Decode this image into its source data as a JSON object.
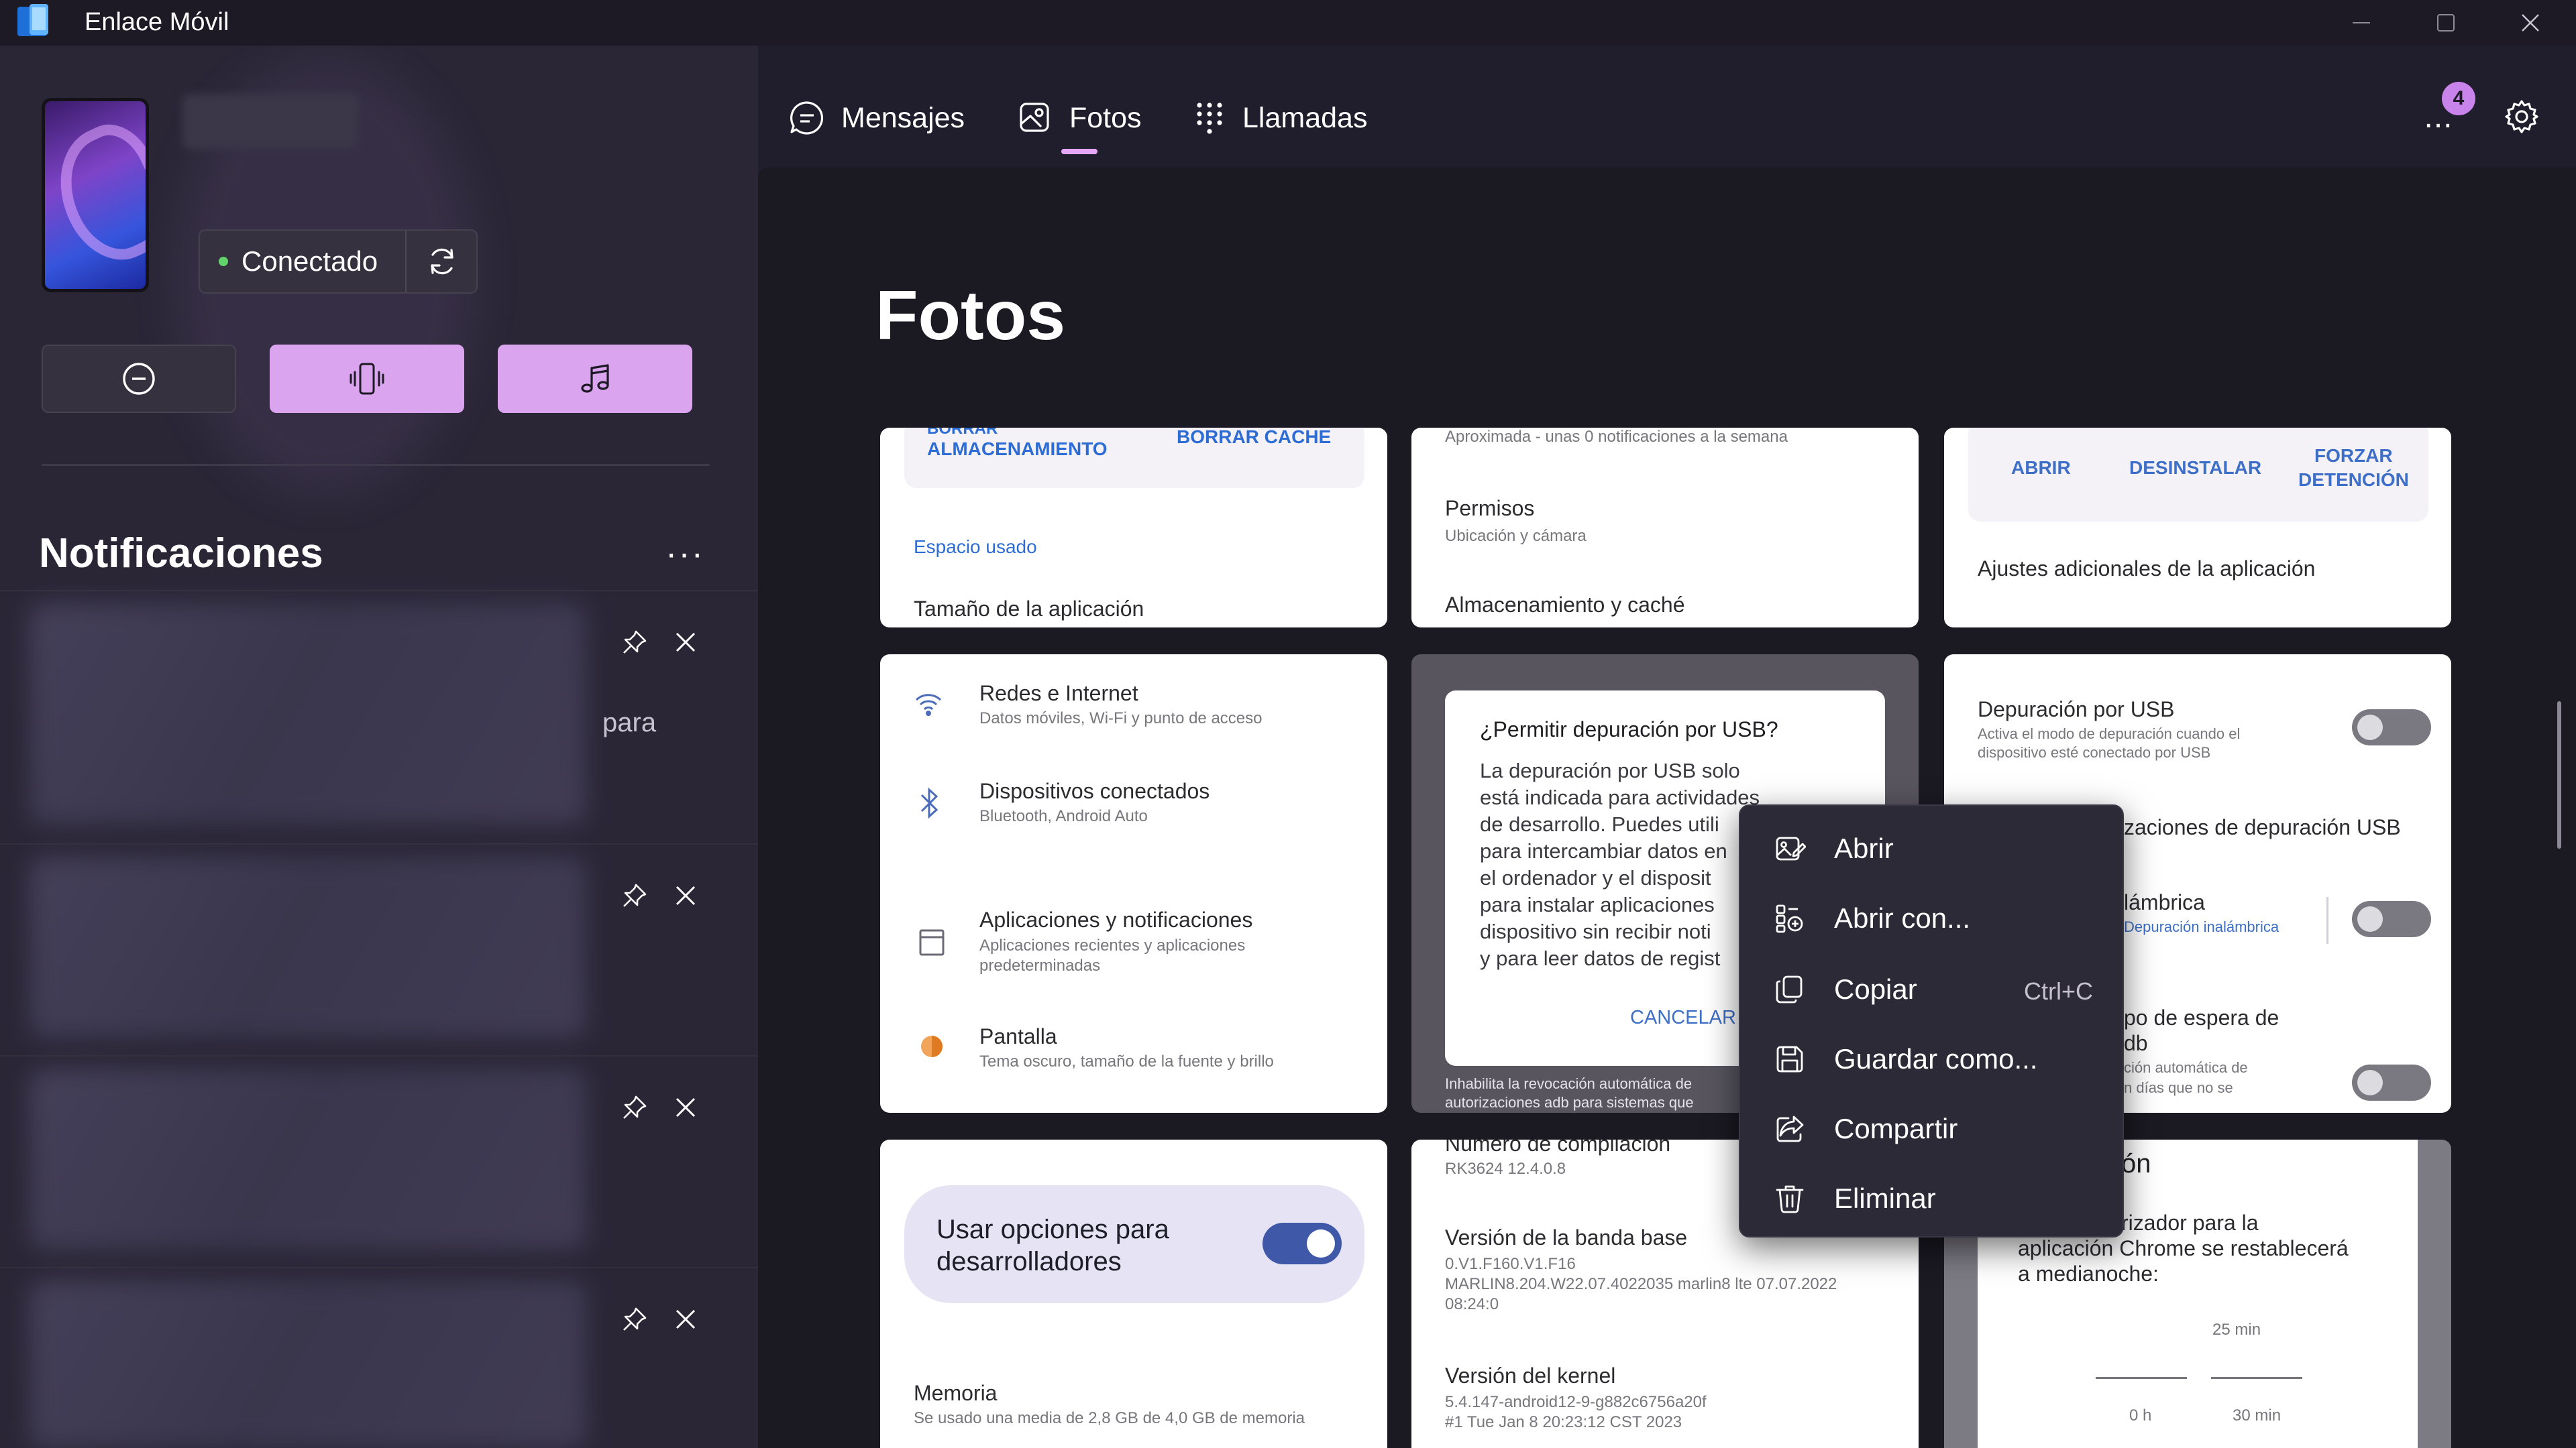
{
  "window": {
    "title": "Enlace Móvil",
    "controls": [
      "minimize-icon",
      "maximize-icon",
      "close-icon"
    ]
  },
  "device": {
    "status": "Conectado",
    "status_color": "#62d26a",
    "quick_actions": [
      "do-not-disturb-icon",
      "vibrate-icon",
      "music-icon"
    ],
    "accent": "#dba4ef"
  },
  "notifications": {
    "title": "Notificaciones",
    "more": "···",
    "items": [
      {
        "text": "para"
      },
      {
        "text": ""
      },
      {
        "text": ""
      },
      {
        "text": ""
      }
    ]
  },
  "tabs": [
    {
      "label": "Mensajes",
      "icon": "chat-icon",
      "active": false
    },
    {
      "label": "Fotos",
      "icon": "photo-icon",
      "active": true
    },
    {
      "label": "Llamadas",
      "icon": "dialpad-icon",
      "active": false
    }
  ],
  "header": {
    "more": "...",
    "badge_count": "4"
  },
  "main": {
    "title": "Fotos"
  },
  "photos": {
    "p1": {
      "btn_storage_top": "BORRAR",
      "btn_storage": "ALMACENAMIENTO",
      "btn_cache": "BORRAR CACHE",
      "space_used": "Espacio usado",
      "app_size": "Tamaño de la aplicación"
    },
    "p2": {
      "line1": "Aproximada - unas 0 notificaciones a la semana",
      "permisos": "Permisos",
      "permisos_sub": "Ubicación y cámara",
      "storage": "Almacenamiento y caché"
    },
    "p3": {
      "abrir": "ABRIR",
      "desinstalar": "DESINSTALAR",
      "forzar1": "FORZAR",
      "forzar2": "DETENCIÓN",
      "ajustes": "Ajustes adicionales de la aplicación"
    },
    "p4": {
      "items": [
        {
          "title": "Redes e Internet",
          "sub": "Datos móviles, Wi-Fi y punto de acceso"
        },
        {
          "title": "Dispositivos conectados",
          "sub": "Bluetooth, Android Auto"
        },
        {
          "title": "Aplicaciones y notificaciones",
          "sub": "Aplicaciones recientes y aplicaciones predeterminadas"
        },
        {
          "title": "Pantalla",
          "sub": "Tema oscuro, tamaño de la fuente y brillo"
        }
      ]
    },
    "p5": {
      "dialog_title": "¿Permitir depuración por USB?",
      "dialog_lines": [
        "La depuración por USB solo",
        "está indicada para actividades",
        "de desarrollo. Puedes utili",
        "para intercambiar datos en",
        "el ordenador y el disposit",
        "para instalar aplicaciones",
        "dispositivo sin recibir noti",
        "y para leer datos de regist"
      ],
      "cancel": "CANCELAR",
      "footer1": "Inhabilita la revocación automática de",
      "footer2": "autorizaciones adb para sistemas que"
    },
    "p6": {
      "usb_title": "Depuración por USB",
      "usb_sub1": "Activa el modo de depuración cuando el",
      "usb_sub2": "dispositivo esté conectado por USB",
      "revoke": "zaciones de depuración USB",
      "wireless": "lámbrica",
      "wireless_sub": "Depuración inalámbrica",
      "timeout1": "po de espera de",
      "timeout2": "db",
      "timeout_sub1": "ción automática de",
      "timeout_sub2": "n días que no se"
    },
    "p7": {
      "dev_options": "Usar opciones para",
      "dev_options2": "desarrolladores",
      "memoria": "Memoria",
      "memoria_sub": "Se usado una media de 2,8 GB de 4,0 GB de memoria"
    },
    "p8": {
      "top": "Número de compilación",
      "top_sub": "RK3624 12.4.0.8",
      "baseband": "Versión de la banda base",
      "baseband_sub1": "0.V1.F160.V1.F16",
      "baseband_sub2": "MARLIN8.204.W22.07.4022035 marlin8 lte 07.07.2022",
      "baseband_sub3": "08:24:0",
      "kernel": "Versión del kernel",
      "kernel_sub1": "5.4.147-android12-9-g882c6756a20f",
      "kernel_sub2": "#1 Tue Jan 8 20:23:12 CST 2023"
    },
    "p9": {
      "top": "ón",
      "line1": "rizador para la",
      "line2": "aplicación Chrome se restablecerá",
      "line3": "a medianoche:",
      "t1": "25 min",
      "a": "0 h",
      "b": "30 min"
    }
  },
  "context_menu": {
    "items": [
      {
        "label": "Abrir",
        "icon": "open-image-icon",
        "shortcut": ""
      },
      {
        "label": "Abrir con...",
        "icon": "open-with-icon",
        "shortcut": ""
      },
      {
        "label": "Copiar",
        "icon": "copy-icon",
        "shortcut": "Ctrl+C"
      },
      {
        "label": "Guardar como...",
        "icon": "save-icon",
        "shortcut": ""
      },
      {
        "label": "Compartir",
        "icon": "share-icon",
        "shortcut": ""
      },
      {
        "label": "Eliminar",
        "icon": "trash-icon",
        "shortcut": ""
      }
    ]
  }
}
